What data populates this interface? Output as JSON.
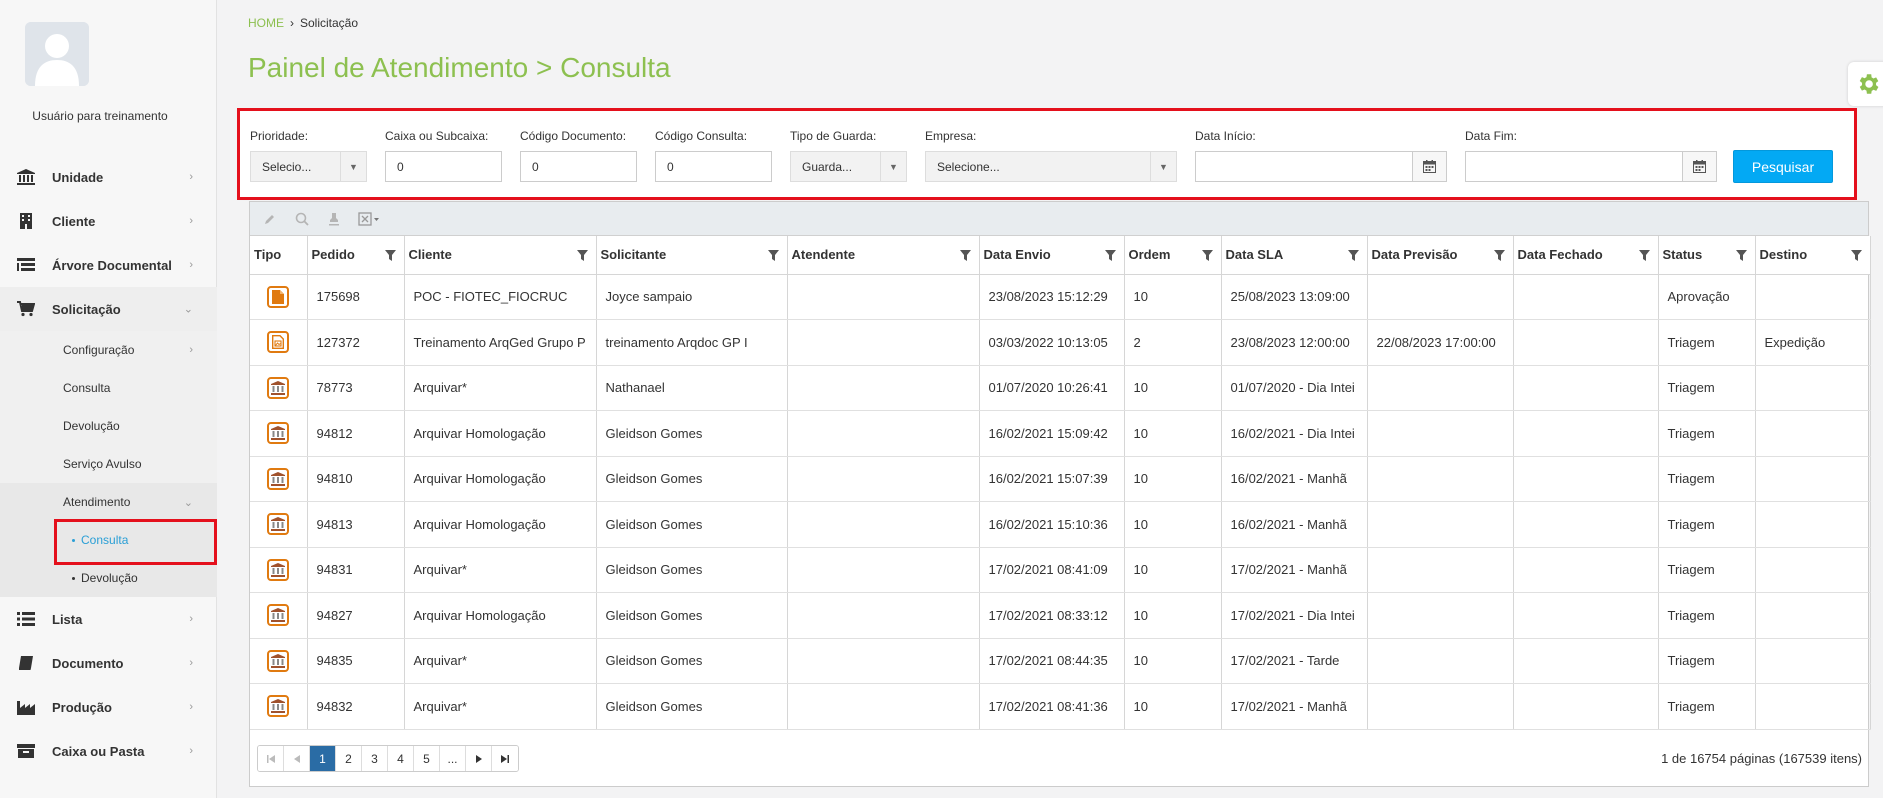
{
  "user": {
    "name": "Usuário para treinamento"
  },
  "nav": {
    "items": [
      {
        "label": "Unidade",
        "icon": "bank-icon"
      },
      {
        "label": "Cliente",
        "icon": "building-icon"
      },
      {
        "label": "Árvore Documental",
        "icon": "tree-icon"
      },
      {
        "label": "Solicitação",
        "icon": "cart-icon"
      }
    ],
    "solicitacao_sub": [
      {
        "label": "Configuração"
      },
      {
        "label": "Consulta"
      },
      {
        "label": "Devolução"
      },
      {
        "label": "Serviço Avulso"
      },
      {
        "label": "Atendimento"
      }
    ],
    "atendimento_sub": [
      {
        "label": "Consulta"
      },
      {
        "label": "Devolução"
      }
    ],
    "items_bottom": [
      {
        "label": "Lista",
        "icon": "list-icon"
      },
      {
        "label": "Documento",
        "icon": "book-icon"
      },
      {
        "label": "Produção",
        "icon": "factory-icon"
      },
      {
        "label": "Caixa ou Pasta",
        "icon": "archive-icon"
      }
    ]
  },
  "breadcrumb": {
    "home": "HOME",
    "current": "Solicitação"
  },
  "page_title": "Painel de Atendimento > Consulta",
  "filters": {
    "prioridade": {
      "label": "Prioridade:",
      "value": "Selecio..."
    },
    "caixa": {
      "label": "Caixa ou Subcaixa:",
      "value": "0"
    },
    "codigo_documento": {
      "label": "Código Documento:",
      "value": "0"
    },
    "codigo_consulta": {
      "label": "Código Consulta:",
      "value": "0"
    },
    "tipo_guarda": {
      "label": "Tipo de Guarda:",
      "value": "Guarda..."
    },
    "empresa": {
      "label": "Empresa:",
      "value": "Selecione..."
    },
    "data_inicio": {
      "label": "Data Início:",
      "value": ""
    },
    "data_fim": {
      "label": "Data Fim:",
      "value": ""
    },
    "search_button": "Pesquisar"
  },
  "table": {
    "columns": [
      "Tipo",
      "Pedido",
      "Cliente",
      "Solicitante",
      "Atendente",
      "Data Envio",
      "Ordem",
      "Data SLA",
      "Data Previsão",
      "Data Fechado",
      "Status",
      "Destino"
    ],
    "rows": [
      {
        "tipo": "document-icon",
        "pedido": "175698",
        "cliente": "POC - FIOTEC_FIOCRUC",
        "solicitante": "Joyce sampaio",
        "atendente": "",
        "data_envio": "23/08/2023 15:12:29",
        "ordem": "10",
        "data_sla": "25/08/2023 13:09:00",
        "data_previsao": "",
        "data_fechado": "",
        "status": "Aprovação",
        "destino": ""
      },
      {
        "tipo": "image-doc-icon",
        "pedido": "127372",
        "cliente": "Treinamento ArqGed Grupo P",
        "solicitante": "treinamento Arqdoc GP I",
        "atendente": "",
        "data_envio": "03/03/2022 10:13:05",
        "ordem": "2",
        "data_sla": "23/08/2023 12:00:00",
        "data_previsao": "22/08/2023 17:00:00",
        "data_fechado": "",
        "status": "Triagem",
        "destino": "Expedição"
      },
      {
        "tipo": "archive-icon",
        "pedido": "78773",
        "cliente": "Arquivar*",
        "solicitante": "Nathanael",
        "atendente": "",
        "data_envio": "01/07/2020 10:26:41",
        "ordem": "10",
        "data_sla": "01/07/2020 - Dia Intei",
        "data_previsao": "",
        "data_fechado": "",
        "status": "Triagem",
        "destino": ""
      },
      {
        "tipo": "archive-icon",
        "pedido": "94812",
        "cliente": "Arquivar Homologação",
        "solicitante": "Gleidson Gomes",
        "atendente": "",
        "data_envio": "16/02/2021 15:09:42",
        "ordem": "10",
        "data_sla": "16/02/2021 - Dia Intei",
        "data_previsao": "",
        "data_fechado": "",
        "status": "Triagem",
        "destino": ""
      },
      {
        "tipo": "archive-icon",
        "pedido": "94810",
        "cliente": "Arquivar Homologação",
        "solicitante": "Gleidson Gomes",
        "atendente": "",
        "data_envio": "16/02/2021 15:07:39",
        "ordem": "10",
        "data_sla": "16/02/2021 - Manhã",
        "data_previsao": "",
        "data_fechado": "",
        "status": "Triagem",
        "destino": ""
      },
      {
        "tipo": "archive-icon",
        "pedido": "94813",
        "cliente": "Arquivar Homologação",
        "solicitante": "Gleidson Gomes",
        "atendente": "",
        "data_envio": "16/02/2021 15:10:36",
        "ordem": "10",
        "data_sla": "16/02/2021 - Manhã",
        "data_previsao": "",
        "data_fechado": "",
        "status": "Triagem",
        "destino": ""
      },
      {
        "tipo": "archive-icon",
        "pedido": "94831",
        "cliente": "Arquivar*",
        "solicitante": "Gleidson Gomes",
        "atendente": "",
        "data_envio": "17/02/2021 08:41:09",
        "ordem": "10",
        "data_sla": "17/02/2021 - Manhã",
        "data_previsao": "",
        "data_fechado": "",
        "status": "Triagem",
        "destino": ""
      },
      {
        "tipo": "archive-icon",
        "pedido": "94827",
        "cliente": "Arquivar Homologação",
        "solicitante": "Gleidson Gomes",
        "atendente": "",
        "data_envio": "17/02/2021 08:33:12",
        "ordem": "10",
        "data_sla": "17/02/2021 - Dia Intei",
        "data_previsao": "",
        "data_fechado": "",
        "status": "Triagem",
        "destino": ""
      },
      {
        "tipo": "archive-icon",
        "pedido": "94835",
        "cliente": "Arquivar*",
        "solicitante": "Gleidson Gomes",
        "atendente": "",
        "data_envio": "17/02/2021 08:44:35",
        "ordem": "10",
        "data_sla": "17/02/2021 - Tarde",
        "data_previsao": "",
        "data_fechado": "",
        "status": "Triagem",
        "destino": ""
      },
      {
        "tipo": "archive-icon",
        "pedido": "94832",
        "cliente": "Arquivar*",
        "solicitante": "Gleidson Gomes",
        "atendente": "",
        "data_envio": "17/02/2021 08:41:36",
        "ordem": "10",
        "data_sla": "17/02/2021 - Manhã",
        "data_previsao": "",
        "data_fechado": "",
        "status": "Triagem",
        "destino": ""
      }
    ]
  },
  "pager": {
    "pages": [
      "1",
      "2",
      "3",
      "4",
      "5",
      "..."
    ],
    "current": 1,
    "info": "1 de 16754 páginas (167539 itens)"
  },
  "colors": {
    "accent_green": "#8dc050",
    "primary_blue": "#03a9f4",
    "highlight_red": "#e4101c",
    "icon_orange": "#e07a10"
  }
}
